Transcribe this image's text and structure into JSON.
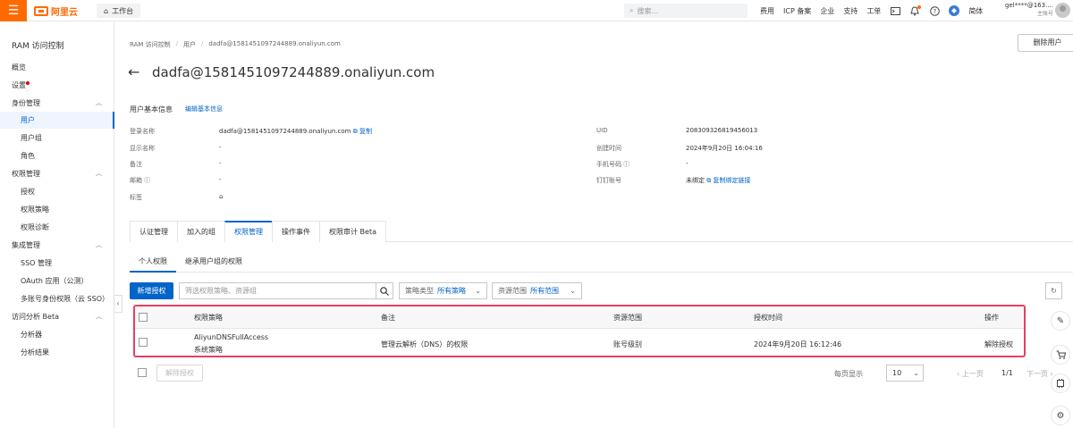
{
  "topnav": {
    "brand": "阿里云",
    "workbench": "工作台",
    "search_placeholder": "搜索...",
    "links": [
      "费用",
      "ICP 备案",
      "企业",
      "支持",
      "工单"
    ],
    "lang": "简体",
    "account_name": "gel****@163....",
    "account_sub": "主账号"
  },
  "sidebar": {
    "title": "RAM 访问控制",
    "items": [
      {
        "label": "概览",
        "type": "top"
      },
      {
        "label": "设置",
        "type": "top",
        "dot": true
      },
      {
        "label": "身份管理",
        "type": "group"
      },
      {
        "label": "用户",
        "type": "child",
        "active": true
      },
      {
        "label": "用户组",
        "type": "child"
      },
      {
        "label": "角色",
        "type": "child"
      },
      {
        "label": "权限管理",
        "type": "group"
      },
      {
        "label": "授权",
        "type": "child"
      },
      {
        "label": "权限策略",
        "type": "child"
      },
      {
        "label": "权限诊断",
        "type": "child"
      },
      {
        "label": "集成管理",
        "type": "group"
      },
      {
        "label": "SSO 管理",
        "type": "child"
      },
      {
        "label": "OAuth 应用（公测）",
        "type": "child"
      },
      {
        "label": "多账号身份权限（云 SSO）",
        "type": "child"
      },
      {
        "label": "访问分析 Beta",
        "type": "group"
      },
      {
        "label": "分析器",
        "type": "child"
      },
      {
        "label": "分析结果",
        "type": "child"
      }
    ]
  },
  "breadcrumb": [
    "RAM 访问控制",
    "用户",
    "dadfa@1581451097244889.onaliyun.com"
  ],
  "header": {
    "delete_button": "删除用户",
    "title": "dadfa@1581451097244889.onaliyun.com"
  },
  "basic_info": {
    "section_title": "用户基本信息",
    "edit_link": "编辑基本信息",
    "left": [
      {
        "label": "登录名称",
        "value": "dadfa@1581451097244889.onaliyun.com",
        "action": "复制"
      },
      {
        "label": "显示名称",
        "value": "-"
      },
      {
        "label": "备注",
        "value": "-"
      },
      {
        "label": "邮箱",
        "value": "-",
        "help": true
      },
      {
        "label": "标签",
        "value": ""
      }
    ],
    "right": [
      {
        "label": "UID",
        "value": "208309326819456013"
      },
      {
        "label": "创建时间",
        "value": "2024年9月20日 16:04:16"
      },
      {
        "label": "手机号码",
        "value": "-",
        "help": true
      },
      {
        "label": "钉钉账号",
        "value": "未绑定",
        "action": "复制绑定链接"
      }
    ]
  },
  "tabs": [
    "认证管理",
    "加入的组",
    "权限管理",
    "操作事件",
    "权限审计 Beta"
  ],
  "active_tab": 2,
  "subtabs": [
    "个人权限",
    "继承用户组的权限"
  ],
  "toolbar": {
    "add_button": "新增授权",
    "filter_placeholder": "筛选权限策略、资源组",
    "policy_type_label": "策略类型",
    "policy_type_value": "所有策略",
    "scope_label": "资源范围",
    "scope_value": "所有范围"
  },
  "table": {
    "headers": [
      "权限策略",
      "备注",
      "资源范围",
      "授权时间",
      "操作"
    ],
    "rows": [
      {
        "policy": "AliyunDNSFullAccess",
        "policy_type": "系统策略",
        "note": "管理云解析（DNS）的权限",
        "scope": "账号级别",
        "time": "2024年9月20日 16:12:46",
        "action": "解除授权"
      }
    ]
  },
  "footer": {
    "revoke_button": "解除授权",
    "per_page_label": "每页显示",
    "per_page_value": "10",
    "prev": "上一页",
    "page": "1/1",
    "next": "下一页"
  }
}
